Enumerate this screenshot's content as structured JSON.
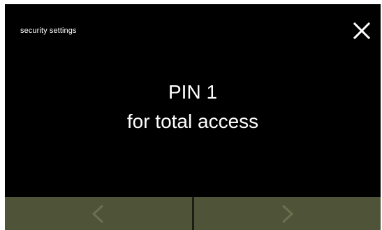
{
  "header": {
    "title": "security settings",
    "close_icon": "close-icon"
  },
  "main": {
    "message_lines": [
      "PIN 1",
      "for total access"
    ]
  },
  "navigation": {
    "previous_icon": "chevron-left-icon",
    "next_icon": "chevron-right-icon"
  },
  "colors": {
    "background": "#000000",
    "text": "#ffffff",
    "nav_button": "#4f5438",
    "nav_arrow": "#6b7050"
  }
}
